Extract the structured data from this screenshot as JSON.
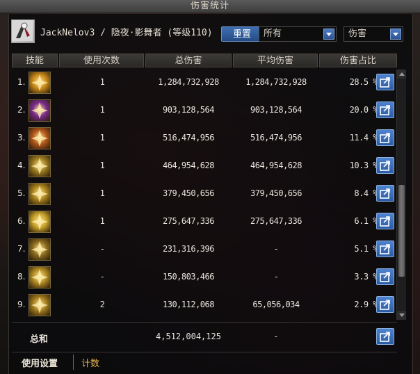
{
  "window": {
    "title": "伤害统计"
  },
  "header": {
    "character": "JackNelov3 / 隐夜·影舞者 (等级110)",
    "reset_label": "重置",
    "filter_1": "所有",
    "filter_2": "伤害"
  },
  "table": {
    "columns": [
      "技能",
      "使用次数",
      "总伤害",
      "平均伤害",
      "伤害占比"
    ],
    "rows": [
      {
        "index": "1.",
        "uses": "1",
        "total": "1,284,732,928",
        "avg": "1,284,732,928",
        "pct": "28.5 %",
        "icon": "gold-burst-skill-icon",
        "color": "#c98a1a"
      },
      {
        "index": "2.",
        "uses": "1",
        "total": "903,128,564",
        "avg": "903,128,564",
        "pct": "20.0 %",
        "icon": "purple-slash-skill-icon",
        "color": "#7a2c8a"
      },
      {
        "index": "3.",
        "uses": "1",
        "total": "516,474,956",
        "avg": "516,474,956",
        "pct": "11.4 %",
        "icon": "flame-dash-skill-icon",
        "color": "#b0561c"
      },
      {
        "index": "4.",
        "uses": "1",
        "total": "464,954,628",
        "avg": "464,954,628",
        "pct": "10.3 %",
        "icon": "gold-wings-skill-icon",
        "color": "#9a7a20"
      },
      {
        "index": "5.",
        "uses": "1",
        "total": "379,450,656",
        "avg": "379,450,656",
        "pct": "8.4 %",
        "icon": "gold-strike-skill-icon",
        "color": "#a8821e"
      },
      {
        "index": "6.",
        "uses": "1",
        "total": "275,647,336",
        "avg": "275,647,336",
        "pct": "6.1 %",
        "icon": "star-explosion-skill-icon",
        "color": "#c7a22a"
      },
      {
        "index": "7.",
        "uses": "-",
        "total": "231,316,396",
        "avg": "-",
        "pct": "5.1 %",
        "icon": "silhouette-skill-icon",
        "color": "#8a6a1e"
      },
      {
        "index": "8.",
        "uses": "-",
        "total": "150,803,466",
        "avg": "-",
        "pct": "3.3 %",
        "icon": "gold-arrow-skill-icon",
        "color": "#b08a24"
      },
      {
        "index": "9.",
        "uses": "2",
        "total": "130,112,068",
        "avg": "65,056,034",
        "pct": "2.9 %",
        "icon": "gold-dash-skill-icon",
        "color": "#a07a1e"
      }
    ],
    "total_row": {
      "label": "总和",
      "total": "4,512,004,125",
      "avg": "-"
    }
  },
  "footer": {
    "tab_settings": "使用设置",
    "tab_count": "计数"
  },
  "colors": {
    "accent": "#2a5ba6",
    "gold": "#e6b24a"
  }
}
